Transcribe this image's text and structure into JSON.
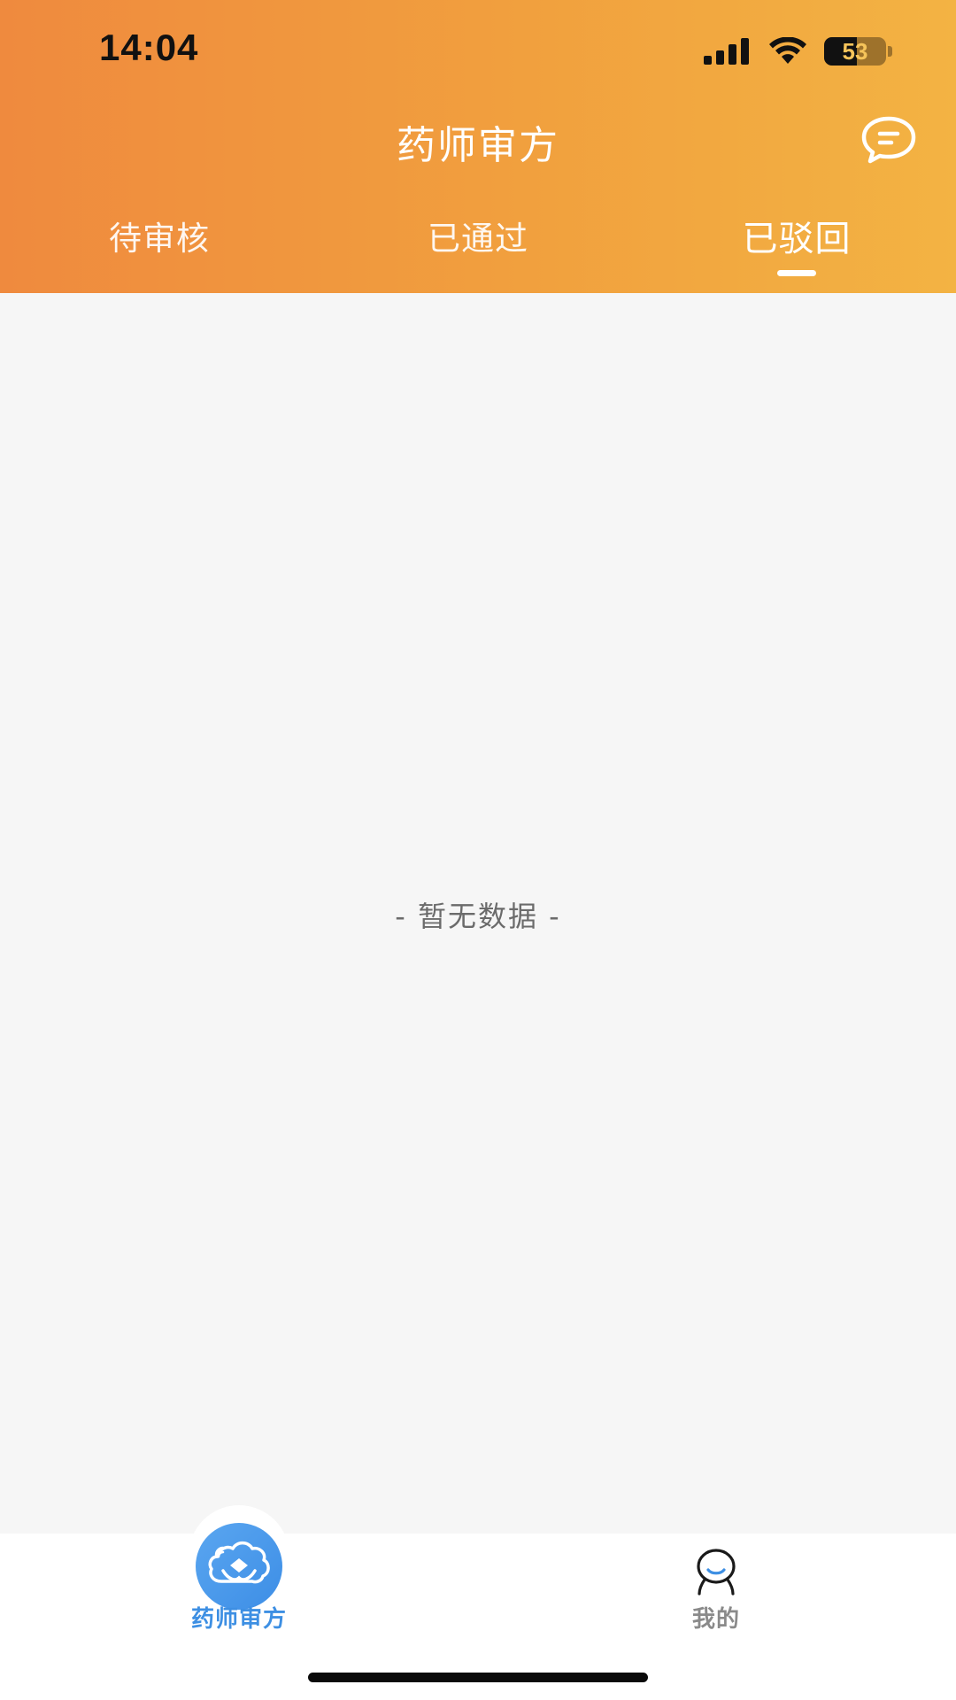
{
  "status_bar": {
    "time": "14:04",
    "battery_level": "53",
    "battery_fraction": 0.53,
    "icons": [
      "signal-icon",
      "wifi-icon",
      "battery-icon"
    ]
  },
  "nav": {
    "title": "药师审方",
    "message_icon": "message-icon"
  },
  "tabs": [
    {
      "label": "待审核",
      "active": false
    },
    {
      "label": "已通过",
      "active": false
    },
    {
      "label": "已驳回",
      "active": true
    }
  ],
  "content": {
    "empty_text": "- 暂无数据 -"
  },
  "tabbar": {
    "items": [
      {
        "label": "药师审方",
        "icon": "pharmacist-review-icon",
        "active": true
      },
      {
        "label": "我的",
        "icon": "profile-icon",
        "active": false
      }
    ]
  },
  "colors": {
    "header_gradient_start": "#ef8a3e",
    "header_gradient_end": "#f3b343",
    "active_tab_blue": "#3d8fe3",
    "inactive_tab_gray": "#8a8a8a",
    "background": "#f6f6f6"
  }
}
